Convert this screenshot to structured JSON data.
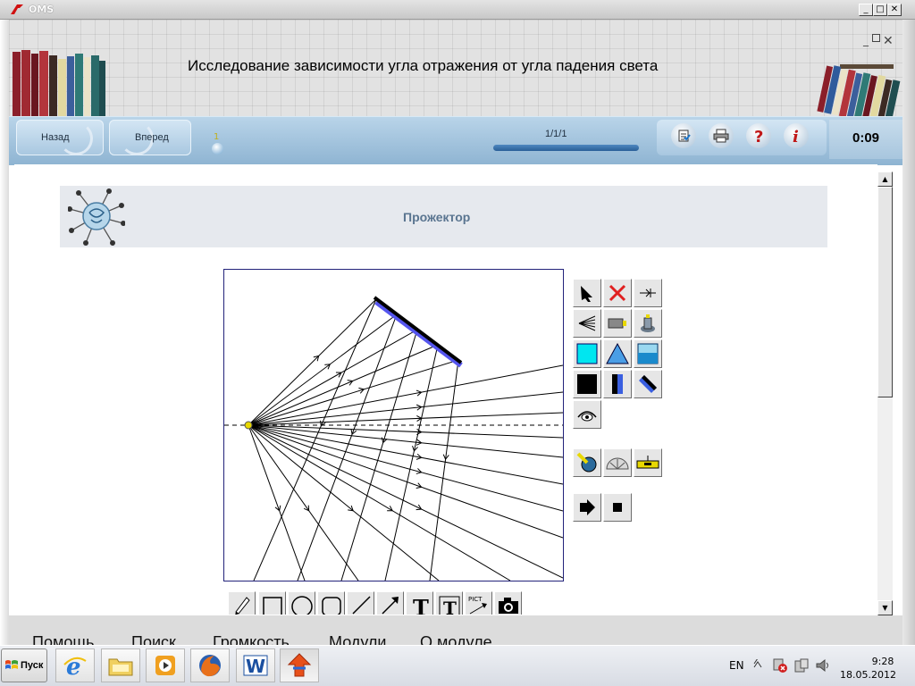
{
  "window": {
    "title": "OMS",
    "minimize": "_",
    "maximize": "□",
    "close": "✕"
  },
  "banner": {
    "heading": "Исследование зависимости угла отражения от угла падения света"
  },
  "nav": {
    "back_label": "Назад",
    "forward_label": "Вперед",
    "page_number": "1",
    "progress_text": "1/1/1",
    "progress_fraction": 1.0,
    "tools": [
      "report-icon",
      "print-icon",
      "help-icon",
      "info-icon"
    ],
    "timer": "0:09"
  },
  "section": {
    "title": "Прожектор"
  },
  "scene": {
    "description_icon": "virus-like-logo-icon",
    "source": "point-light-source",
    "mirror": "flat-mirror",
    "colors": {
      "mirror": "#000000",
      "mirror_back": "#5555ee",
      "ray": "#000000",
      "source": "#e8d800",
      "frame": "#22227a"
    }
  },
  "palette": {
    "rows": [
      [
        "cursor-icon",
        "delete-icon",
        "ray-icon"
      ],
      [
        "beam-source-icon",
        "lamp-icon",
        "lamp-stand-icon"
      ],
      [
        "cyan-block-icon",
        "prism-icon",
        "liquid-container-icon"
      ],
      [
        "black-block-icon",
        "vertical-mirror-icon",
        "diagonal-mirror-icon"
      ],
      [
        "eye-icon"
      ],
      [
        "tape-measure-icon",
        "protractor-icon",
        "ruler-icon"
      ],
      [
        "play-icon",
        "stop-icon"
      ]
    ]
  },
  "draw_tools": [
    "pencil-icon",
    "rectangle-icon",
    "ellipse-icon",
    "rounded-rect-icon",
    "line-icon",
    "arrow-icon",
    "text-icon",
    "text-box-icon",
    "pict-icon",
    "camera-icon"
  ],
  "draw_tool_labels": {
    "text": "T",
    "text_box": "T",
    "pict": "PICT"
  },
  "menu": {
    "items": [
      "Помощь",
      "Поиск",
      "Громкость",
      "Модули",
      "О модуле"
    ]
  },
  "taskbar": {
    "start_label": "Пуск",
    "apps": [
      "internet-explorer-icon",
      "folder-icon",
      "media-player-icon",
      "firefox-icon",
      "word-icon",
      "oms-icon"
    ],
    "language": "EN",
    "time": "9:28",
    "date": "18.05.2012"
  }
}
